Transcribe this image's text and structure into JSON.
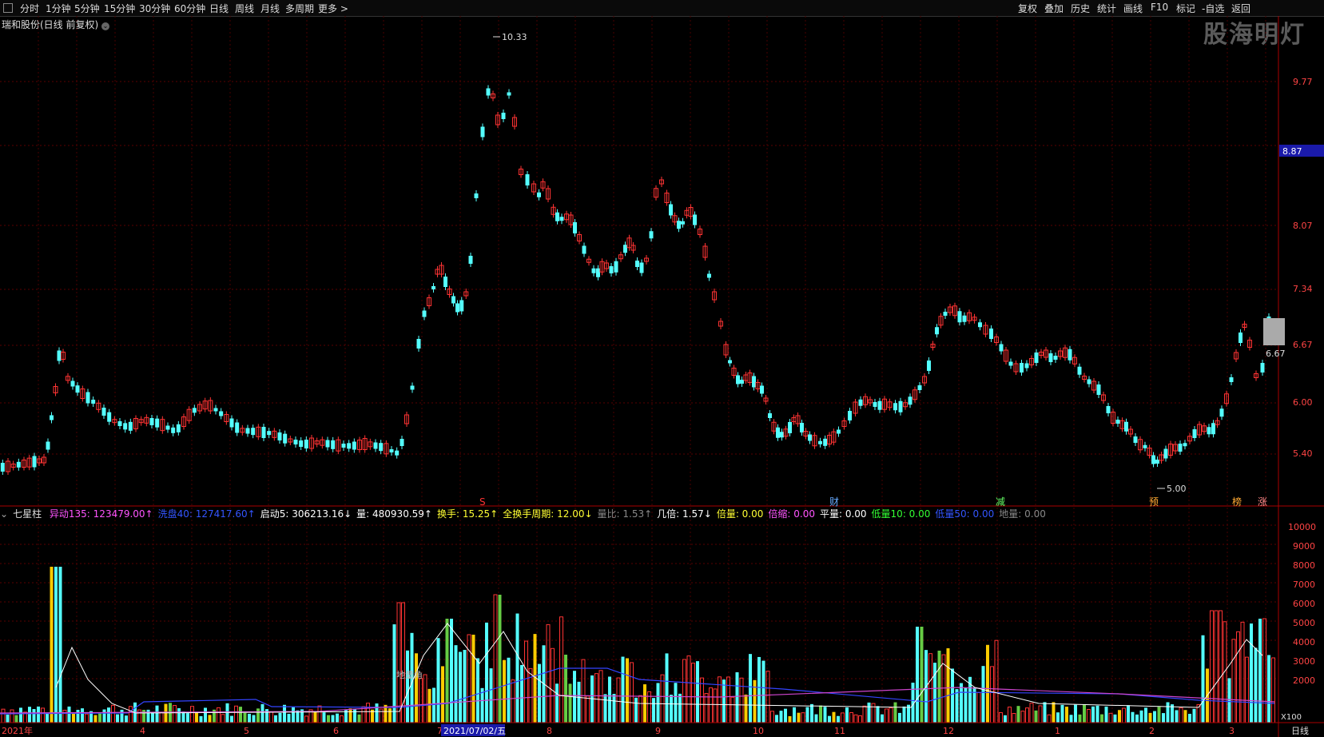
{
  "toolbar": {
    "periods": [
      "分时",
      "1分钟",
      "5分钟",
      "15分钟",
      "30分钟",
      "60分钟",
      "日线",
      "周线",
      "月线",
      "多周期",
      "更多 >"
    ],
    "right_buttons": [
      "复权",
      "叠加",
      "历史",
      "统计",
      "画线",
      "F10",
      "标记",
      "-自选",
      "返回"
    ]
  },
  "watermark": "股海明灯",
  "stock_title": "瑞和股份(日线 前复权)",
  "price_axis": {
    "labels": [
      "9.77",
      "8.87",
      "8.07",
      "7.34",
      "6.67",
      "6.00",
      "5.40"
    ],
    "current_price": "8.87",
    "high_label": "10.33",
    "low_label": "5.00",
    "last_label": "6.67"
  },
  "markers": [
    "S",
    "财",
    "减",
    "预",
    "榜",
    "涨"
  ],
  "indicator": {
    "name": "七星柱",
    "items": [
      {
        "label": "异动135:",
        "value": "123479.00",
        "arrow": "↑",
        "color": "#ff55ff"
      },
      {
        "label": "洗盘40:",
        "value": "127417.60",
        "arrow": "↑",
        "color": "#3355ff"
      },
      {
        "label": "启动5:",
        "value": "306213.16",
        "arrow": "↓",
        "color": "#ffffff"
      },
      {
        "label": "量:",
        "value": "480930.59",
        "arrow": "↑",
        "color": "#ffffff"
      },
      {
        "label": "换手:",
        "value": "15.25",
        "arrow": "↑",
        "color": "#ffff33"
      },
      {
        "label": "全换手周期:",
        "value": "12.00",
        "arrow": "↓",
        "color": "#ffff33"
      },
      {
        "label": "量比:",
        "value": "1.53",
        "arrow": "↑",
        "color": "#888888"
      },
      {
        "label": "几倍:",
        "value": "1.57",
        "arrow": "↓",
        "color": "#ffffff"
      },
      {
        "label": "倍量:",
        "value": "0.00",
        "arrow": "",
        "color": "#ffff33"
      },
      {
        "label": "倍缩:",
        "value": "0.00",
        "arrow": "",
        "color": "#ff55ff"
      },
      {
        "label": "平量:",
        "value": "0.00",
        "arrow": "",
        "color": "#ffffff"
      },
      {
        "label": "低量10:",
        "value": "0.00",
        "arrow": "",
        "color": "#33ff33"
      },
      {
        "label": "低量50:",
        "value": "0.00",
        "arrow": "",
        "color": "#3355ff"
      },
      {
        "label": "地量:",
        "value": "0.00",
        "arrow": "",
        "color": "#888888"
      }
    ],
    "in_chart_label": "地量角"
  },
  "volume_axis": {
    "labels": [
      "10000",
      "9000",
      "8000",
      "7000",
      "6000",
      "5000",
      "4000",
      "3000",
      "2000"
    ],
    "unit": "X100"
  },
  "time_axis": {
    "labels": [
      "2021年",
      "4",
      "5",
      "6",
      "7",
      "2021/07/02/五",
      "8",
      "9",
      "10",
      "11",
      "12",
      "1",
      "2",
      "3"
    ],
    "period": "日线"
  },
  "colors": {
    "up": "#ff3333",
    "down": "#54ffff",
    "volume_hl": "#ffcc00"
  }
}
